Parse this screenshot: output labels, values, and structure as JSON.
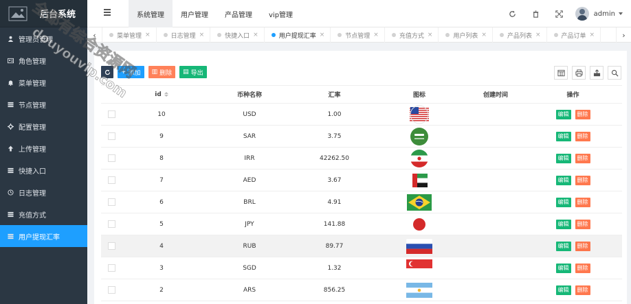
{
  "brand": {
    "title": "后台系统"
  },
  "sidebar": {
    "items": [
      {
        "label": "管理员管理",
        "icon": "user-icon",
        "active": false
      },
      {
        "label": "角色管理",
        "icon": "id-card-icon",
        "active": false
      },
      {
        "label": "菜单管理",
        "icon": "bell-icon",
        "active": false
      },
      {
        "label": "节点管理",
        "icon": "list-icon",
        "active": false
      },
      {
        "label": "配置管理",
        "icon": "gear-icon",
        "active": false
      },
      {
        "label": "上传管理",
        "icon": "upload-icon",
        "active": false
      },
      {
        "label": "快捷入口",
        "icon": "list-icon",
        "active": false
      },
      {
        "label": "日志管理",
        "icon": "clock-icon",
        "active": false
      },
      {
        "label": "充值方式",
        "icon": "list-icon",
        "active": false
      },
      {
        "label": "用户提现汇率",
        "icon": "list-icon",
        "active": true
      }
    ]
  },
  "header": {
    "nav": [
      {
        "label": "系统管理",
        "active": true
      },
      {
        "label": "用户管理",
        "active": false
      },
      {
        "label": "产品管理",
        "active": false
      },
      {
        "label": "vip管理",
        "active": false
      }
    ],
    "user": "admin"
  },
  "tabs": [
    {
      "label": "菜单管理",
      "active": false
    },
    {
      "label": "日志管理",
      "active": false
    },
    {
      "label": "快捷入口",
      "active": false
    },
    {
      "label": "用户提现汇率",
      "active": true
    },
    {
      "label": "节点管理",
      "active": false
    },
    {
      "label": "充值方式",
      "active": false
    },
    {
      "label": "用户列表",
      "active": false
    },
    {
      "label": "产品列表",
      "active": false
    },
    {
      "label": "产品订单",
      "active": false
    }
  ],
  "toolbar": {
    "add": "添加",
    "delete": "删除",
    "export": "导出"
  },
  "table": {
    "headers": {
      "id": "id",
      "name": "币种名称",
      "rate": "汇率",
      "icon": "图标",
      "time": "创建时间",
      "op": "操作"
    },
    "edit_label": "编辑",
    "delete_label": "删除",
    "rows": [
      {
        "id": "10",
        "name": "USD",
        "rate": "1.00",
        "flag": "us"
      },
      {
        "id": "9",
        "name": "SAR",
        "rate": "3.75",
        "flag": "sa"
      },
      {
        "id": "8",
        "name": "IRR",
        "rate": "42262.50",
        "flag": "ir"
      },
      {
        "id": "7",
        "name": "AED",
        "rate": "3.67",
        "flag": "ae"
      },
      {
        "id": "6",
        "name": "BRL",
        "rate": "4.91",
        "flag": "br"
      },
      {
        "id": "5",
        "name": "JPY",
        "rate": "141.88",
        "flag": "jp"
      },
      {
        "id": "4",
        "name": "RUB",
        "rate": "89.77",
        "flag": "ru",
        "highlight": true
      },
      {
        "id": "3",
        "name": "SGD",
        "rate": "1.32",
        "flag": "sg"
      },
      {
        "id": "2",
        "name": "ARS",
        "rate": "856.25",
        "flag": "ar"
      }
    ]
  },
  "watermark": {
    "line1": "全都有综合资源网",
    "line2": "douyouvip.com"
  }
}
